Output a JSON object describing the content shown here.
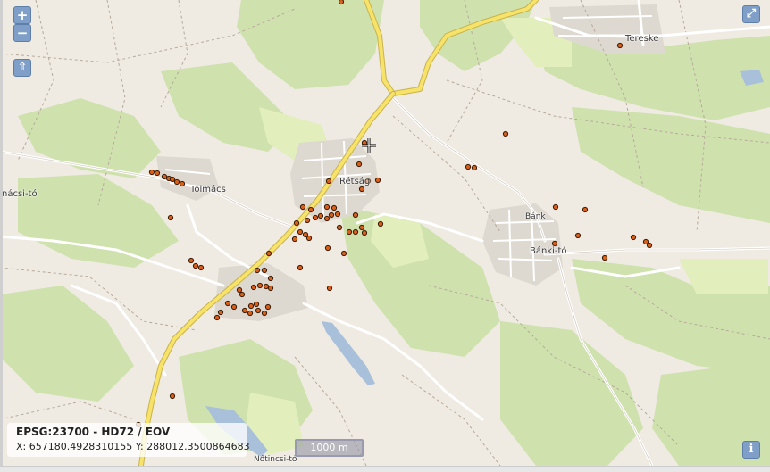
{
  "map": {
    "controls": {
      "zoom_in": "+",
      "zoom_out": "−",
      "pan_up": "⇧",
      "fullscreen": "⤢",
      "info": "i"
    },
    "places": [
      {
        "name": "Tereske",
        "key": "tereske"
      },
      {
        "name": "Rétság",
        "key": "retsag"
      },
      {
        "name": "Tolmács",
        "key": "tolmacs"
      },
      {
        "name": "nácsi-tó",
        "key": "tolmacsi_to"
      },
      {
        "name": "Bánk",
        "key": "bank"
      },
      {
        "name": "Bánki-tó",
        "key": "banki_to"
      },
      {
        "name": "Nőtincsi-tó",
        "key": "notincsi_to"
      }
    ],
    "projection_label": "EPSG:23700 - HD72 / EOV",
    "coordinates_text": "X: 657180.4928310155 Y: 288012.3500864683",
    "scale_label": "1000 m",
    "colors": {
      "land": "#efeae2",
      "forest": "#c9dfa9",
      "meadow": "#dfeeb9",
      "main_road": "#f7e26a",
      "road": "#ffffff",
      "water": "#9fb8d3",
      "marker_fill": "#d95f17",
      "marker_stroke": "#3a1a05",
      "control_bg": "#7f9fc8"
    }
  }
}
